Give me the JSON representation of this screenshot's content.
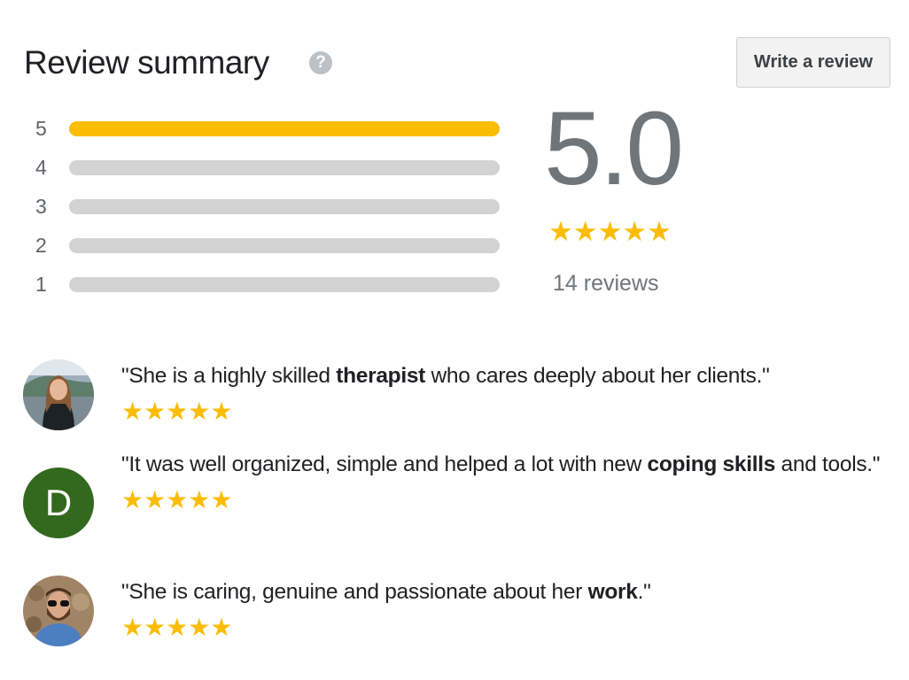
{
  "header": {
    "title": "Review summary",
    "help_icon": "question-circle-icon",
    "write_review_label": "Write a review"
  },
  "distribution": [
    {
      "stars": "5",
      "fraction": 1.0
    },
    {
      "stars": "4",
      "fraction": 0
    },
    {
      "stars": "3",
      "fraction": 0
    },
    {
      "stars": "2",
      "fraction": 0
    },
    {
      "stars": "1",
      "fraction": 0
    }
  ],
  "summary": {
    "rating": "5.0",
    "stars": 5,
    "count_label": "14 reviews"
  },
  "colors": {
    "star": "#fbbc04",
    "bar_track": "#d3d3d3",
    "avatar_d": "#33691e",
    "muted": "#70757a"
  },
  "reviews": [
    {
      "avatar": "photo-woman",
      "parts": [
        [
          "\"She is a highly skilled ",
          false
        ],
        [
          "therapist",
          true
        ],
        [
          " who cares deeply about her clients.\"",
          false
        ]
      ],
      "stars": 5
    },
    {
      "avatar": "letter",
      "initial": "D",
      "parts": [
        [
          "\"It was well organized, simple and helped a lot with new ",
          false
        ],
        [
          "coping skills",
          true
        ],
        [
          " and tools.\"",
          false
        ]
      ],
      "stars": 5
    },
    {
      "avatar": "photo-man",
      "parts": [
        [
          "\"She is caring, genuine and passionate about her ",
          false
        ],
        [
          "work",
          true
        ],
        [
          ".\"",
          false
        ]
      ],
      "stars": 5
    }
  ]
}
